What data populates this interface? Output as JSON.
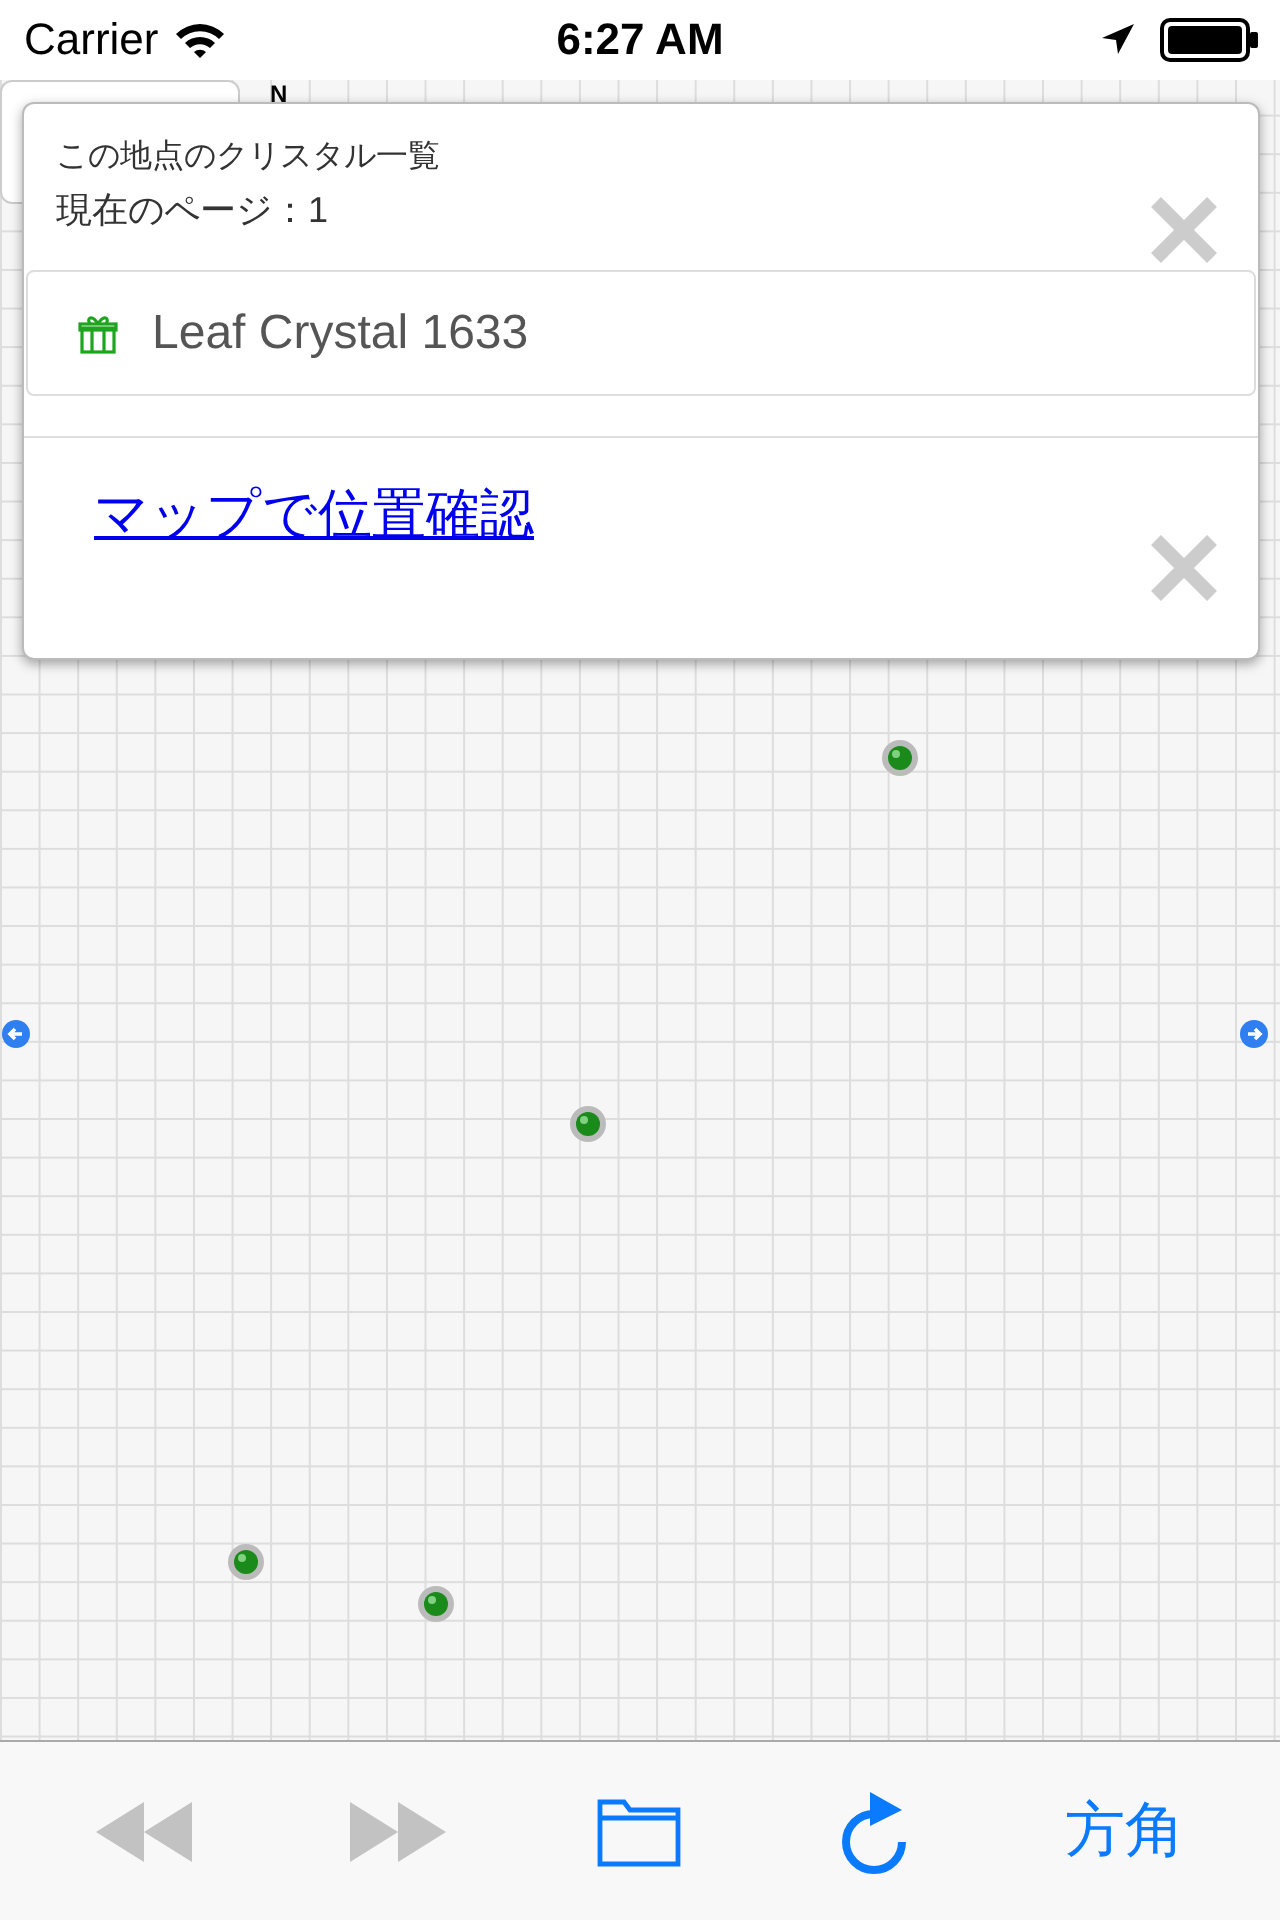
{
  "status_bar": {
    "carrier": "Carrier",
    "time": "6:27 AM"
  },
  "map": {
    "compass": "N"
  },
  "popup": {
    "title": "この地点のクリスタル一覧",
    "page": "現在のページ：1",
    "items": [
      {
        "label": "Leaf Crystal 1633"
      }
    ],
    "link": "マップで位置確認"
  },
  "toolbar": [
    {
      "kind": "rewind",
      "disabled": true
    },
    {
      "kind": "fast_forward",
      "disabled": true
    },
    {
      "kind": "folder",
      "disabled": false
    },
    {
      "kind": "refresh",
      "disabled": false
    },
    {
      "kind": "text",
      "label": "方角",
      "disabled": false
    }
  ]
}
